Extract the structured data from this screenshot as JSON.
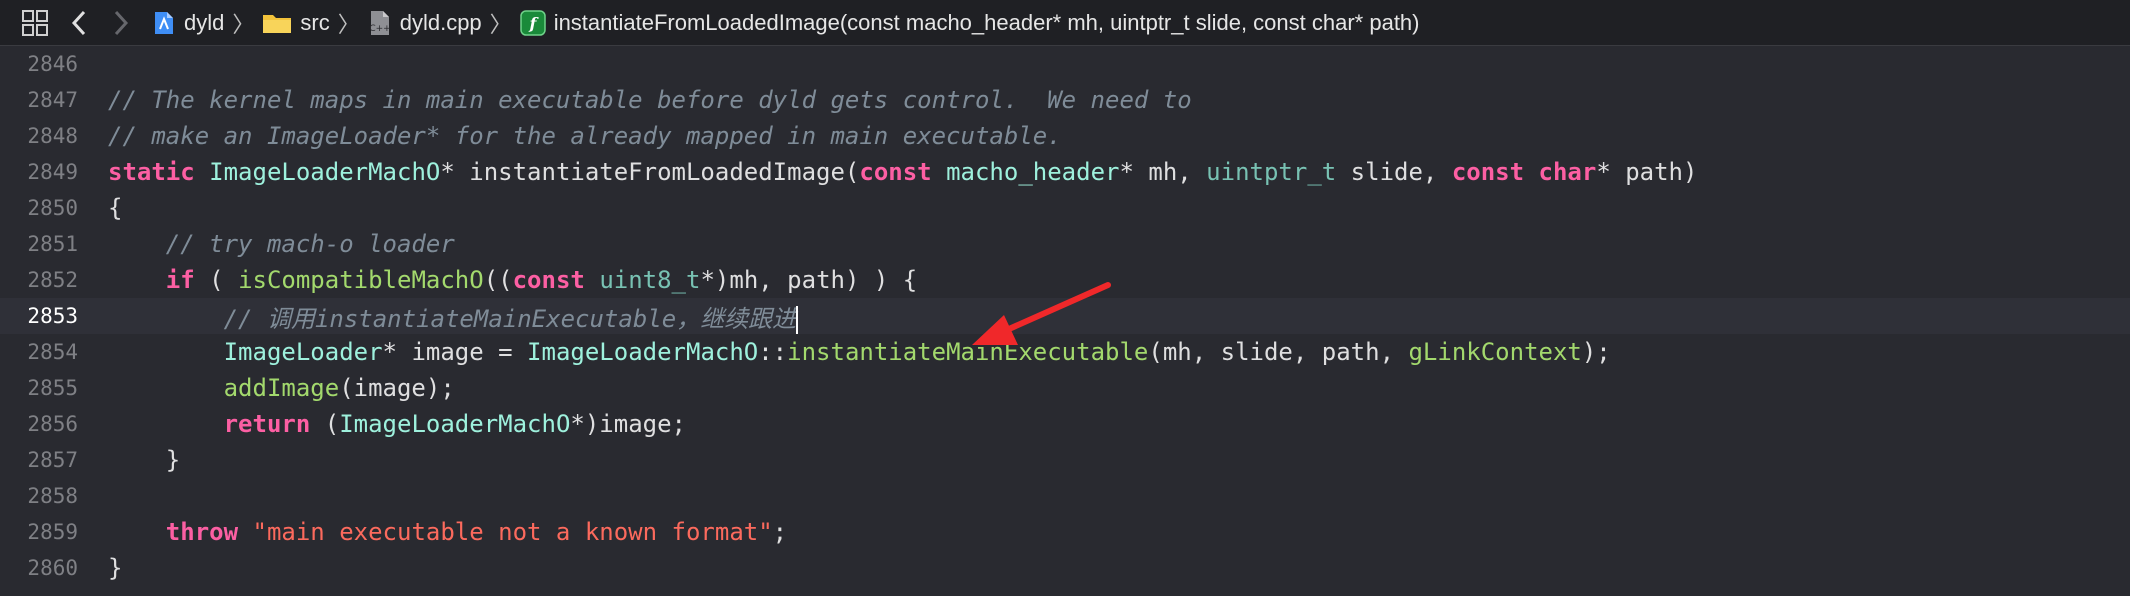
{
  "toolbar": {
    "crumbs": [
      {
        "label": "dyld",
        "icon": "project-icon"
      },
      {
        "label": "src",
        "icon": "folder-icon"
      },
      {
        "label": "dyld.cpp",
        "icon": "cpp-file-icon"
      },
      {
        "label": "instantiateFromLoadedImage(const macho_header* mh, uintptr_t slide, const char* path)",
        "icon": "function-icon"
      }
    ],
    "cpp_glyph": "C++",
    "func_glyph": "f"
  },
  "editor": {
    "current_line": "2853",
    "lines": [
      {
        "n": "2846"
      },
      {
        "n": "2847",
        "c1": "// The kernel maps in main executable before dyld gets control.  We need to"
      },
      {
        "n": "2848",
        "c1": "// make an ImageLoader* for the already mapped in main executable."
      },
      {
        "n": "2849",
        "kw1": "static",
        "sp1": " ",
        "ty1": "ImageLoaderMachO",
        "p1": "* instantiateFromLoadedImage(",
        "kw2": "const",
        "sp2": " ",
        "ty2": "macho_header",
        "p2": "* mh, ",
        "pt1": "uintptr_t",
        "p3": " slide, ",
        "kw3": "const",
        "sp3": " ",
        "kw4": "char",
        "p4": "* path)"
      },
      {
        "n": "2850",
        "p1": "{"
      },
      {
        "n": "2851",
        "c1": "    // try mach-o loader"
      },
      {
        "n": "2852",
        "sp0": "    ",
        "kw1": "if",
        "p1": " ( ",
        "fn1": "isCompatibleMachO",
        "p2": "((",
        "kw2": "const",
        "sp1": " ",
        "pt1": "uint8_t",
        "p3": "*)mh, path) ) {"
      },
      {
        "n": "2853",
        "c1": "        // 调用instantiateMainExecutable，继续跟进"
      },
      {
        "n": "2854",
        "sp0": "        ",
        "ty1": "ImageLoader",
        "p1": "* image = ",
        "ty2": "ImageLoaderMachO",
        "p2": "::",
        "fn1": "instantiateMainExecutable",
        "p3": "(mh, slide, path, ",
        "fn2": "gLinkContext",
        "p4": ");"
      },
      {
        "n": "2855",
        "sp0": "        ",
        "fn1": "addImage",
        "p1": "(image);"
      },
      {
        "n": "2856",
        "sp0": "        ",
        "kw1": "return",
        "p1": " (",
        "ty1": "ImageLoaderMachO",
        "p2": "*)image;"
      },
      {
        "n": "2857",
        "p1": "    }"
      },
      {
        "n": "2858"
      },
      {
        "n": "2859",
        "sp0": "    ",
        "kw1": "throw",
        "sp1": " ",
        "str1": "\"main executable not a known format\"",
        "p1": ";"
      },
      {
        "n": "2860",
        "p1": "}"
      }
    ]
  },
  "annotation": {
    "arrow_color": "#f0282a"
  }
}
